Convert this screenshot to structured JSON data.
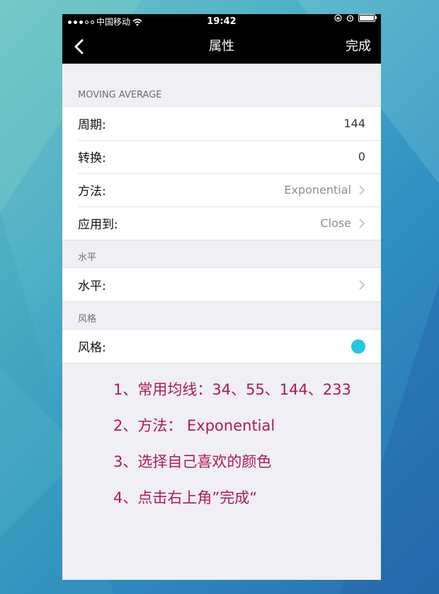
{
  "status_bar": {
    "carrier": "中国移动",
    "time": "19:42"
  },
  "nav": {
    "title": "属性",
    "done_label": "完成"
  },
  "sections": {
    "moving_average": {
      "header": "MOVING AVERAGE",
      "rows": [
        {
          "label": "周期:",
          "value": "144"
        },
        {
          "label": "转换:",
          "value": "0"
        },
        {
          "label": "方法:",
          "value": "Exponential"
        },
        {
          "label": "应用到:",
          "value": "Close"
        }
      ]
    },
    "level": {
      "header": "水平",
      "row_label": "水平:"
    },
    "style": {
      "header": "风格",
      "row_label": "风格:",
      "color": "#23c7e0"
    }
  },
  "notes": [
    "1、常用均线：34、55、144、233",
    "2、方法： Exponential",
    "3、选择自己喜欢的颜色",
    "4、点击右上角”完成“"
  ],
  "colors": {
    "note_text": "#b01c4a",
    "accent_swatch": "#23c7e0"
  }
}
